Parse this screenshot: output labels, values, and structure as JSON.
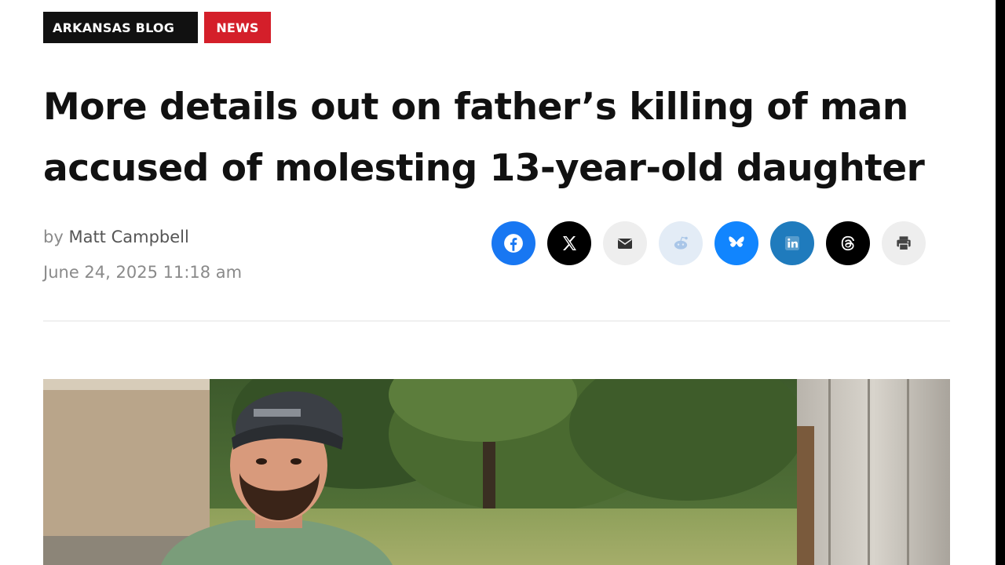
{
  "article": {
    "tags": [
      "ARKANSAS BLOG",
      "NEWS"
    ],
    "headline_line1": "More details out on father’s killing of man",
    "headline_line2": "accused of molesting 13-year-old daughter",
    "byline_prefix": "by",
    "author": "Matt Campbell",
    "date": "June 24, 2025 11:18 am"
  },
  "share_icons": [
    "facebook-icon",
    "x-icon",
    "email-icon",
    "reddit-icon",
    "bluesky-icon",
    "linkedin-icon",
    "threads-icon",
    "print-icon"
  ],
  "colors": {
    "news_tag": "#d41f2a",
    "blog_tag": "#111111",
    "facebook": "#1877f2",
    "bluesky": "#1185fe",
    "linkedin": "#1f7bbd"
  }
}
